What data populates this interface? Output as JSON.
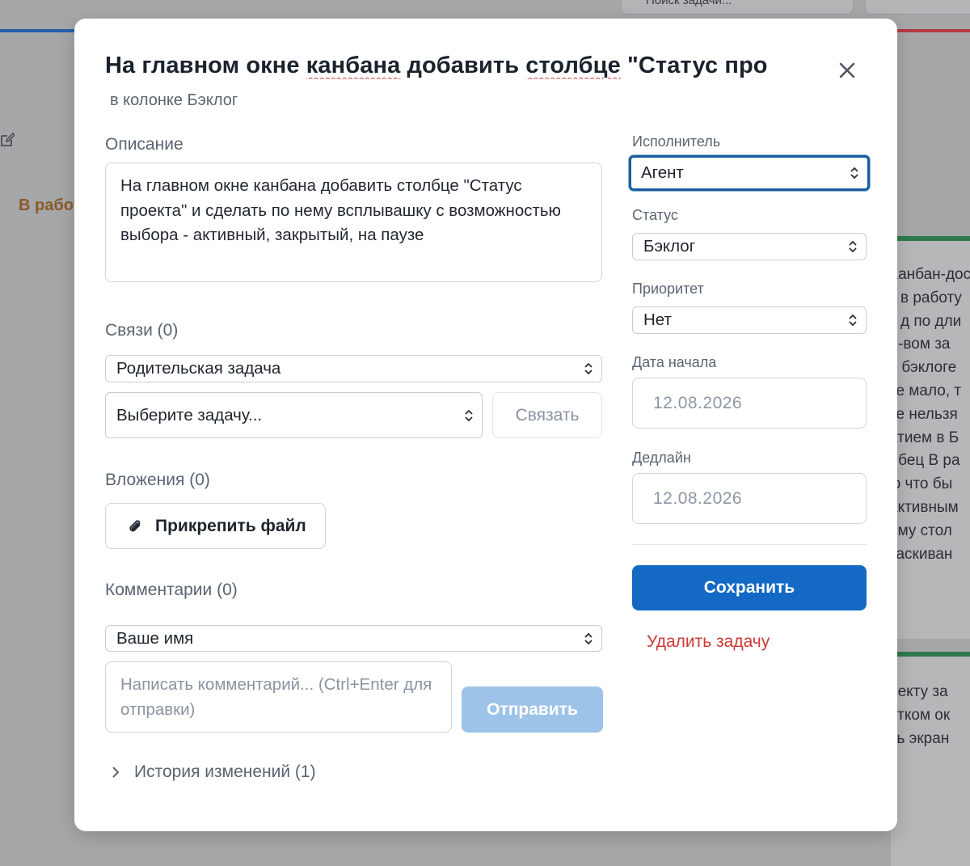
{
  "background": {
    "top_button_1": "Поиск задачи...",
    "column_title": "В работе",
    "card_1_lines": [
      "Канбан-доска",
      "т в работу",
      "т д по дли",
      "л-вом за",
      "в бэклоге",
      "те мало, т",
      "те нельзя",
      "атием в Б",
      "лбец В ра",
      "ю что бы",
      "активным",
      "ому стол",
      "таскиван"
    ],
    "card_2_lines": [
      "оекту за",
      "отком ок",
      "сь экран"
    ],
    "colors": {
      "overlay": "#a6a7a9",
      "stripe_left": "#2a5fa8",
      "stripe_right": "#b9383f",
      "card_accent": "#2f7a4d"
    }
  },
  "modal": {
    "title_parts": [
      "На главном окне ",
      "канбана",
      " добавить ",
      "столбце",
      " \"Статус про"
    ],
    "subtitle": "в колонке Бэклог",
    "close_icon": "close-icon",
    "description": {
      "label": "Описание",
      "value": "На главном окне канбана добавить столбце \"Статус проекта\" и сделать по нему всплывашку с возможностью выбора - активный, закрытый, на паузе"
    },
    "links": {
      "label": "Связи (0)",
      "type_select": "Родительская задача",
      "task_select": "Выберите задачу...",
      "link_button": "Связать"
    },
    "attachments": {
      "label": "Вложения (0)",
      "attach_button": "Прикрепить файл",
      "attach_icon": "paperclip-icon"
    },
    "comments": {
      "label": "Комментарии (0)",
      "author_select": "Ваше имя",
      "placeholder": "Написать комментарий... (Ctrl+Enter для отправки)",
      "send_button": "Отправить"
    },
    "history": {
      "label": "История изменений (1)",
      "icon": "chevron-right-icon"
    },
    "sidebar": {
      "assignee_label": "Исполнитель",
      "assignee_value": "Агент",
      "status_label": "Статус",
      "status_value": "Бэклог",
      "priority_label": "Приоритет",
      "priority_value": "Нет",
      "start_date_label": "Дата начала",
      "start_date_value": "12.08.2026",
      "deadline_label": "Дедлайн",
      "deadline_value": "12.08.2026",
      "save_button": "Сохранить",
      "delete_link": "Удалить задачу"
    },
    "colors": {
      "primary": "#1369c4",
      "primary_disabled": "#9ec3e8",
      "danger": "#cc3a36",
      "focus_ring": "#1a5d9e"
    }
  }
}
